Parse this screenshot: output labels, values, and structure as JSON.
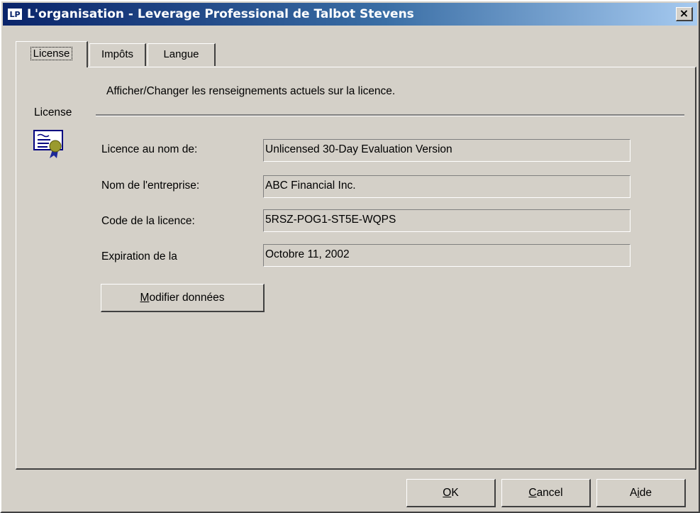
{
  "window": {
    "app_icon_text": "LP",
    "title": "L'organisation - Leverage Professional de Talbot Stevens",
    "close_glyph": "×"
  },
  "tabs": [
    {
      "label": "License",
      "active": true
    },
    {
      "label": "Impôts",
      "active": false
    },
    {
      "label": "Langue",
      "active": false
    }
  ],
  "license_panel": {
    "description": "Afficher/Changer les renseignements actuels sur la licence.",
    "group_label": "License",
    "icon": "certificate-icon",
    "fields": [
      {
        "label": "Licence au nom de:",
        "value": "Unlicensed 30-Day Evaluation Version"
      },
      {
        "label": "Nom de l'entreprise:",
        "value": "ABC Financial Inc."
      },
      {
        "label": "Code de la licence:",
        "value": "5RSZ-POG1-ST5E-WQPS"
      },
      {
        "label": "Expiration de la",
        "value": "Octobre 11, 2002"
      }
    ],
    "modify_button": {
      "accel": "M",
      "rest": "odifier données"
    }
  },
  "footer": {
    "ok": {
      "accel": "O",
      "rest": "K"
    },
    "cancel": {
      "accel": "C",
      "rest": "ancel"
    },
    "help": {
      "pre": "A",
      "accel": "i",
      "rest": "de"
    }
  }
}
